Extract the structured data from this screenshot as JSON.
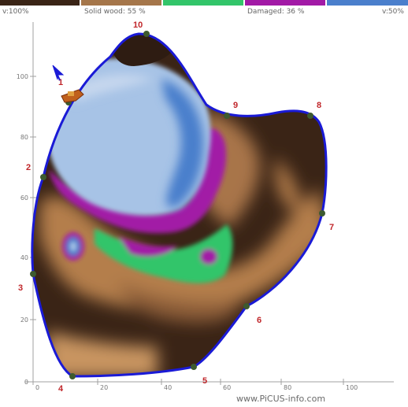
{
  "legend": {
    "segments": [
      {
        "color": "#3a2416"
      },
      {
        "color": "#a5764a"
      },
      {
        "color": "#33c56a"
      },
      {
        "color": "#a21aa6"
      },
      {
        "color": "#4a7fcc"
      }
    ],
    "labels": {
      "left": "v:100%",
      "solid": "Solid wood: 55 %",
      "damaged": "Damaged: 36 %",
      "right": "v:50%"
    }
  },
  "axes": {
    "y_ticks": [
      "0",
      "20",
      "40",
      "60",
      "80",
      "100"
    ],
    "x_ticks": [
      "0",
      "20",
      "40",
      "60",
      "80",
      "100"
    ]
  },
  "sensors": [
    "1",
    "2",
    "3",
    "4",
    "5",
    "6",
    "7",
    "8",
    "9",
    "10"
  ],
  "watermark": "www.PiCUS-info.com",
  "colors": {
    "outline": "#1a1ad6",
    "sensor_label": "#c0262a",
    "sensor_dot": "#3d5a2f",
    "axis": "#a0a0a0"
  },
  "icons": [
    "compass-arrow-icon",
    "hammer-icon"
  ]
}
